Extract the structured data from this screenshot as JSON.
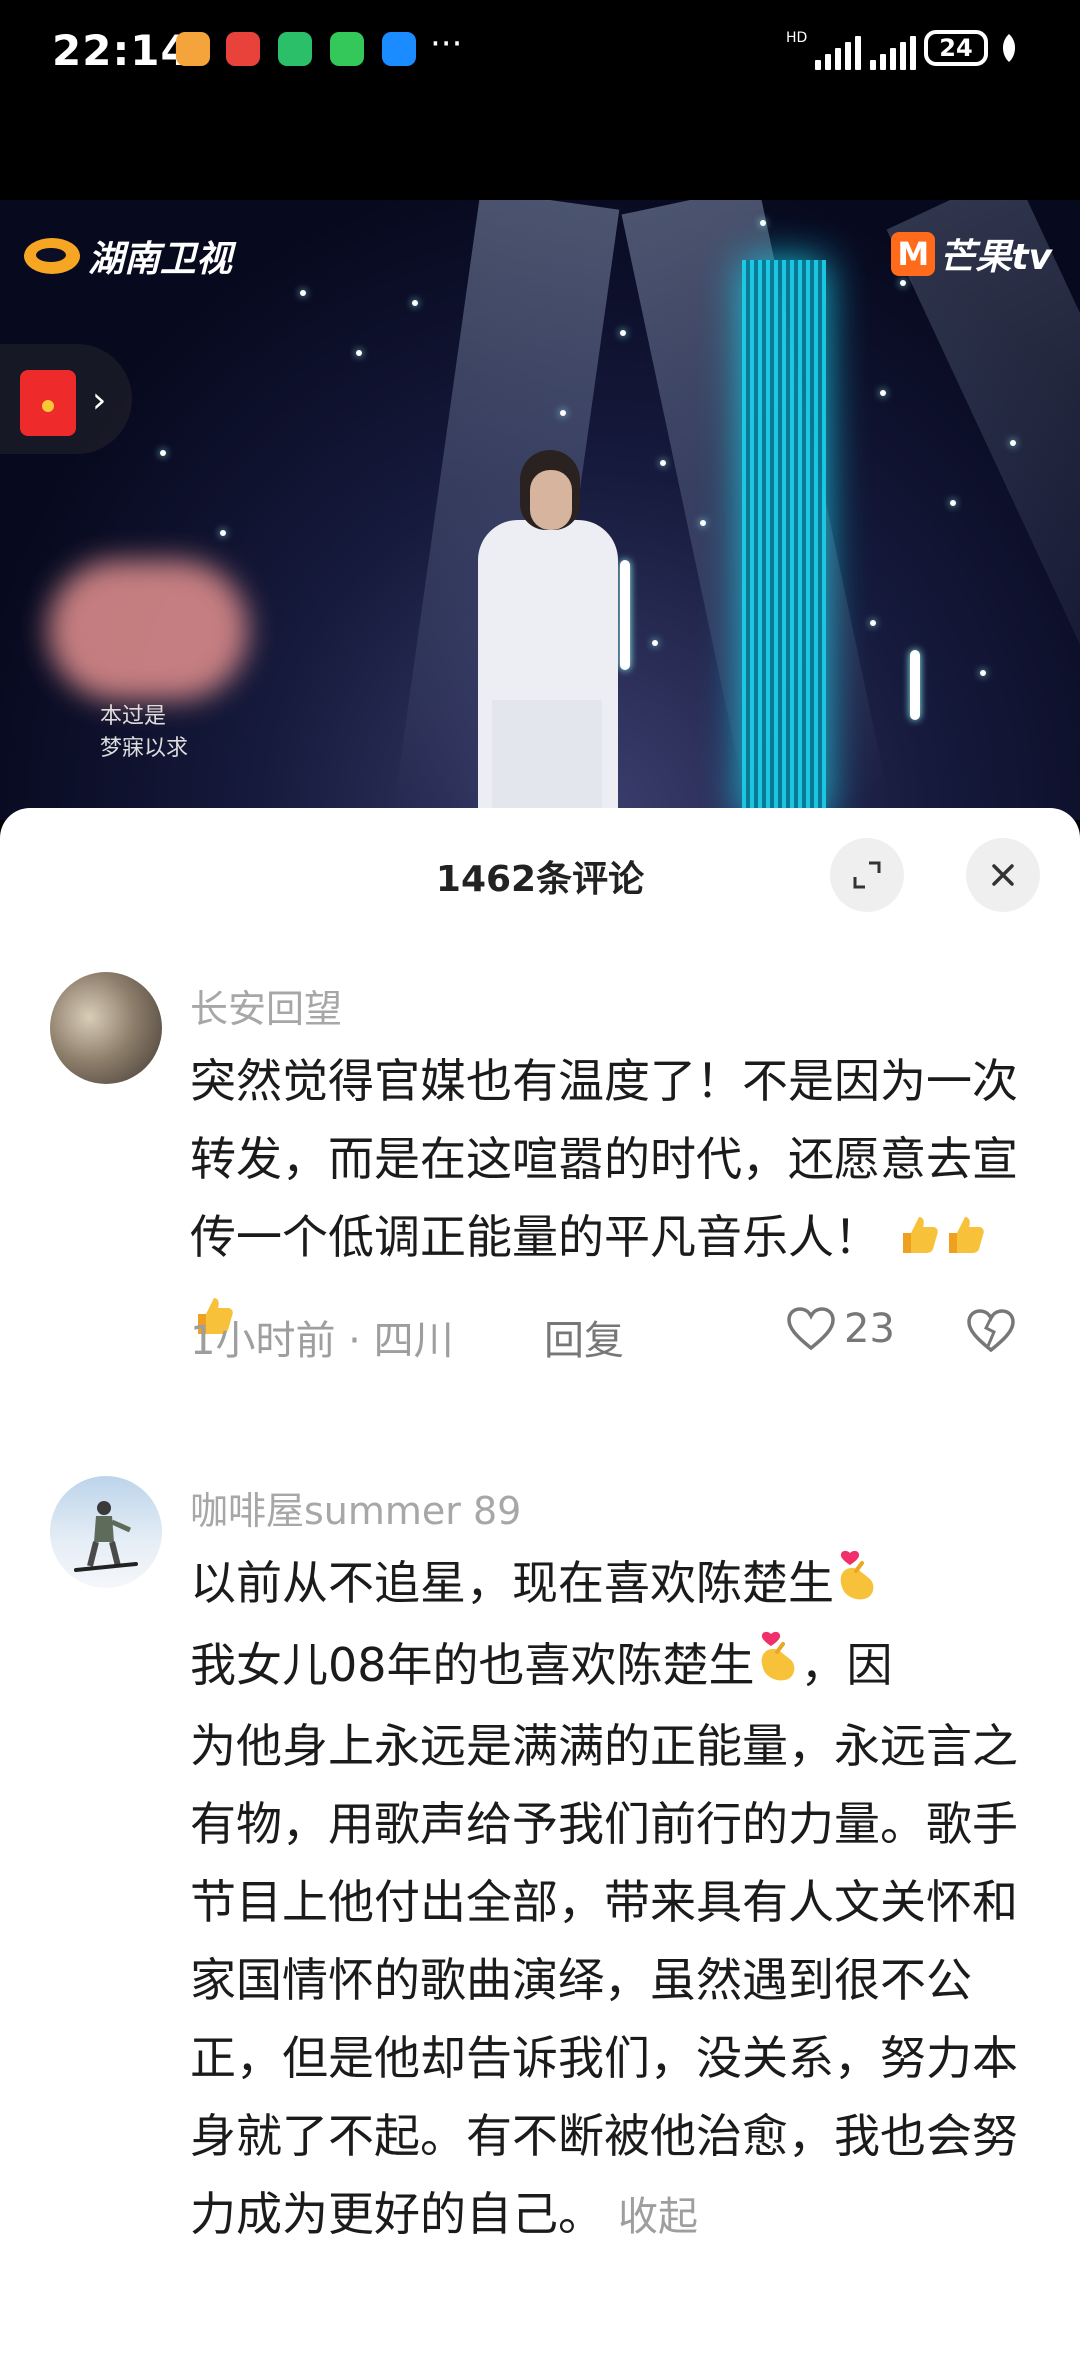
{
  "status_bar": {
    "time": "22:14",
    "battery": "24",
    "app_icons": [
      "huawei-store-icon",
      "huawei-icon",
      "hourglass-icon",
      "wechat-icon",
      "message-icon"
    ],
    "app_colors": [
      "#f4a43a",
      "#e8423b",
      "#2bbf6a",
      "#34c759",
      "#1a8cff"
    ],
    "more": "···",
    "signal_label": "HD"
  },
  "video": {
    "channel_logo": "湖南卫视",
    "platform_logo": "芒果tv",
    "platform_badge": "M",
    "lyrics": [
      "本过是",
      "梦寐以求"
    ]
  },
  "comments_panel": {
    "title": "1462条评论",
    "comments": [
      {
        "user": "长安回望",
        "text": "突然觉得官媒也有温度了！不是因为一次转发，而是在这喧嚣的时代，还愿意去宣传一个低调正能量的平凡音乐人！",
        "time_location": "1小时前 · 四川",
        "reply_label": "回复",
        "likes": "23"
      },
      {
        "user": "咖啡屋summer 89",
        "text_line1": "以前从不追星，现在喜欢陈楚生",
        "text_line2a": "我女儿08年的也喜欢陈楚生",
        "text_line2b": "，因",
        "text_rest": "为他身上永远是满满的正能量，永远言之有物，用歌声给予我们前行的力量。歌手节目上他付出全部，带来具有人文关怀和家国情怀的歌曲演绎，虽然遇到很不公正，但是他却告诉我们，没关系，努力本身就了不起。有不断被他治愈，我也会努力成为更好的自己。",
        "collapse_label": "收起"
      }
    ]
  }
}
